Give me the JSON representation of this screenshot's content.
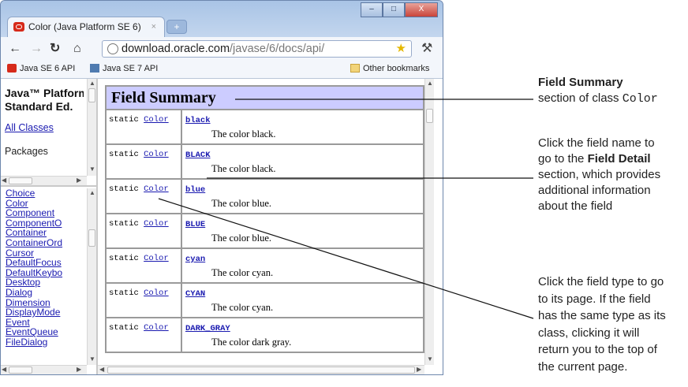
{
  "browser": {
    "tab_title": "Color (Java Platform SE 6)",
    "tab_close": "×",
    "new_tab": "+",
    "url_domain": "download.oracle.com",
    "url_path": "/javase/6/docs/api/",
    "bookmarks": [
      "Java SE 6 API",
      "Java SE 7 API"
    ],
    "other_bookmarks": "Other bookmarks",
    "window_buttons": [
      "–",
      "□",
      "X"
    ]
  },
  "left_pane": {
    "title_line1": "Java™ Platform",
    "title_line2": "Standard Ed.",
    "all_classes": "All Classes",
    "packages": "Packages",
    "classes": [
      "Choice",
      "Color",
      "Component",
      "ComponentO",
      "Container",
      "ContainerOrd",
      "Cursor",
      "DefaultFocus",
      "DefaultKeybo",
      "Desktop",
      "Dialog",
      "Dimension",
      "DisplayMode",
      "Event",
      "EventQueue",
      "FileDialog"
    ]
  },
  "field_summary": {
    "heading": "Field Summary",
    "rows": [
      {
        "modifier": "static",
        "type": "Color",
        "name": "black",
        "desc": "The color black."
      },
      {
        "modifier": "static",
        "type": "Color",
        "name": "BLACK",
        "desc": "The color black."
      },
      {
        "modifier": "static",
        "type": "Color",
        "name": "blue",
        "desc": "The color blue."
      },
      {
        "modifier": "static",
        "type": "Color",
        "name": "BLUE",
        "desc": "The color blue."
      },
      {
        "modifier": "static",
        "type": "Color",
        "name": "cyan",
        "desc": "The color cyan."
      },
      {
        "modifier": "static",
        "type": "Color",
        "name": "CYAN",
        "desc": "The color cyan."
      },
      {
        "modifier": "static",
        "type": "Color",
        "name": "DARK_GRAY",
        "desc": "The color dark gray."
      }
    ]
  },
  "annotations": {
    "a1_bold": "Field Summary",
    "a1_text": "section of class",
    "a1_code": "Color",
    "a2_l1": "Click the field name to",
    "a2_l2a": "go to the",
    "a2_l2b": "Field Detail",
    "a2_l3": "section, which provides",
    "a2_l4": "additional information",
    "a2_l5": "about the field",
    "a3_lines": [
      "Click the field type to go",
      "to its page. If the field",
      "has the same type as its",
      "class, clicking it will",
      "return you to the top of",
      "the current page."
    ]
  },
  "colors": {
    "header_bg": "#ccccff",
    "link": "#1a1ab0",
    "chrome": "#c7d9ef"
  }
}
